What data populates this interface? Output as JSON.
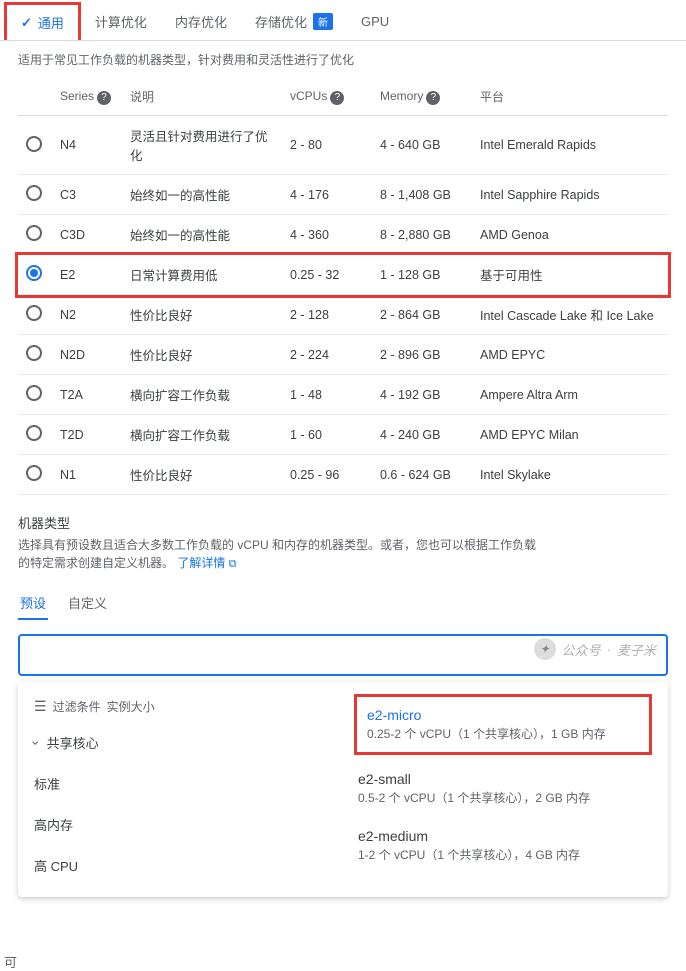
{
  "tabs": [
    {
      "label": "通用",
      "active": true
    },
    {
      "label": "计算优化"
    },
    {
      "label": "内存优化"
    },
    {
      "label": "存储优化",
      "badge": "新"
    },
    {
      "label": "GPU"
    }
  ],
  "subtitle": "适用于常见工作负载的机器类型，针对费用和灵活性进行了优化",
  "table": {
    "headers": {
      "series": "Series",
      "desc": "说明",
      "vcpus": "vCPUs",
      "memory": "Memory",
      "platform": "平台"
    },
    "rows": [
      {
        "series": "N4",
        "desc": "灵活且针对费用进行了优化",
        "vcpus": "2 - 80",
        "memory": "4 - 640 GB",
        "platform": "Intel Emerald Rapids",
        "selected": false
      },
      {
        "series": "C3",
        "desc": "始终如一的高性能",
        "vcpus": "4 - 176",
        "memory": "8 - 1,408 GB",
        "platform": "Intel Sapphire Rapids",
        "selected": false
      },
      {
        "series": "C3D",
        "desc": "始终如一的高性能",
        "vcpus": "4 - 360",
        "memory": "8 - 2,880 GB",
        "platform": "AMD Genoa",
        "selected": false
      },
      {
        "series": "E2",
        "desc": "日常计算费用低",
        "vcpus": "0.25 - 32",
        "memory": "1 - 128 GB",
        "platform": "基于可用性",
        "selected": true
      },
      {
        "series": "N2",
        "desc": "性价比良好",
        "vcpus": "2 - 128",
        "memory": "2 - 864 GB",
        "platform": "Intel Cascade Lake 和 Ice Lake",
        "selected": false
      },
      {
        "series": "N2D",
        "desc": "性价比良好",
        "vcpus": "2 - 224",
        "memory": "2 - 896 GB",
        "platform": "AMD EPYC",
        "selected": false
      },
      {
        "series": "T2A",
        "desc": "横向扩容工作负载",
        "vcpus": "1 - 48",
        "memory": "4 - 192 GB",
        "platform": "Ampere Altra Arm",
        "selected": false
      },
      {
        "series": "T2D",
        "desc": "横向扩容工作负载",
        "vcpus": "1 - 60",
        "memory": "4 - 240 GB",
        "platform": "AMD EPYC Milan",
        "selected": false
      },
      {
        "series": "N1",
        "desc": "性价比良好",
        "vcpus": "0.25 - 96",
        "memory": "0.6 - 624 GB",
        "platform": "Intel Skylake",
        "selected": false
      }
    ]
  },
  "machine_type": {
    "label": "机器类型",
    "desc": "选择具有预设数且适合大多数工作负载的 vCPU 和内存的机器类型。或者，您也可以根据工作负载的特定需求创建自定义机器。",
    "link": "了解详情"
  },
  "subtabs": {
    "preset": "预设",
    "custom": "自定义"
  },
  "popup": {
    "filter_label": "过滤条件",
    "filter_value": "实例大小",
    "left_side_label": "可",
    "categories": [
      {
        "label": "共享核心",
        "chevron": true
      },
      {
        "label": "标准",
        "chevron": false
      },
      {
        "label": "高内存",
        "chevron": false
      },
      {
        "label": "高 CPU",
        "chevron": false
      }
    ],
    "instances": [
      {
        "name": "e2-micro",
        "spec": "0.25-2 个 vCPU（1 个共享核心），1 GB 内存",
        "highlighted": true,
        "blue": true
      },
      {
        "name": "e2-small",
        "spec": "0.5-2 个 vCPU（1 个共享核心），2 GB 内存",
        "highlighted": false,
        "blue": false
      },
      {
        "name": "e2-medium",
        "spec": "1-2 个 vCPU（1 个共享核心），4 GB 内存",
        "highlighted": false,
        "blue": false
      }
    ]
  },
  "watermark": {
    "prefix": "公众号",
    "name": "麦子米"
  }
}
